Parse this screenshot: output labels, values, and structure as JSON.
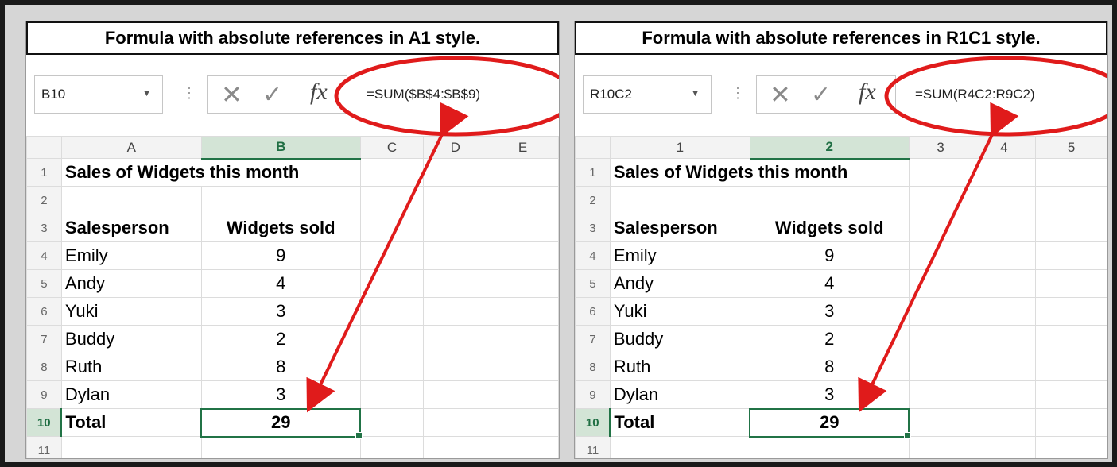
{
  "accent_color": "#217346",
  "annotation_color": "#e01b1b",
  "panels": [
    {
      "caption": "Formula with absolute references in A1 style.",
      "name_box": "B10",
      "formula": "=SUM($B$4:$B$9)",
      "columns": [
        "A",
        "B",
        "C",
        "D",
        "E"
      ],
      "selected_column": 1,
      "row_numbers": [
        "1",
        "2",
        "3",
        "4",
        "5",
        "6",
        "7",
        "8",
        "9",
        "10",
        "11"
      ],
      "title_cell": "Sales of Widgets this month",
      "header": {
        "salesperson": "Salesperson",
        "widgets": "Widgets sold"
      },
      "rows": [
        {
          "name": "Emily",
          "sold": "9"
        },
        {
          "name": "Andy",
          "sold": "4"
        },
        {
          "name": "Yuki",
          "sold": "3"
        },
        {
          "name": "Buddy",
          "sold": "2"
        },
        {
          "name": "Ruth",
          "sold": "8"
        },
        {
          "name": "Dylan",
          "sold": "3"
        }
      ],
      "total_label": "Total",
      "total_value": "29"
    },
    {
      "caption": "Formula with absolute references in R1C1 style.",
      "name_box": "R10C2",
      "formula": "=SUM(R4C2:R9C2)",
      "columns": [
        "1",
        "2",
        "3",
        "4",
        "5"
      ],
      "selected_column": 1,
      "row_numbers": [
        "1",
        "2",
        "3",
        "4",
        "5",
        "6",
        "7",
        "8",
        "9",
        "10",
        "11"
      ],
      "title_cell": "Sales of Widgets this month",
      "header": {
        "salesperson": "Salesperson",
        "widgets": "Widgets sold"
      },
      "rows": [
        {
          "name": "Emily",
          "sold": "9"
        },
        {
          "name": "Andy",
          "sold": "4"
        },
        {
          "name": "Yuki",
          "sold": "3"
        },
        {
          "name": "Buddy",
          "sold": "2"
        },
        {
          "name": "Ruth",
          "sold": "8"
        },
        {
          "name": "Dylan",
          "sold": "3"
        }
      ],
      "total_label": "Total",
      "total_value": "29"
    }
  ]
}
